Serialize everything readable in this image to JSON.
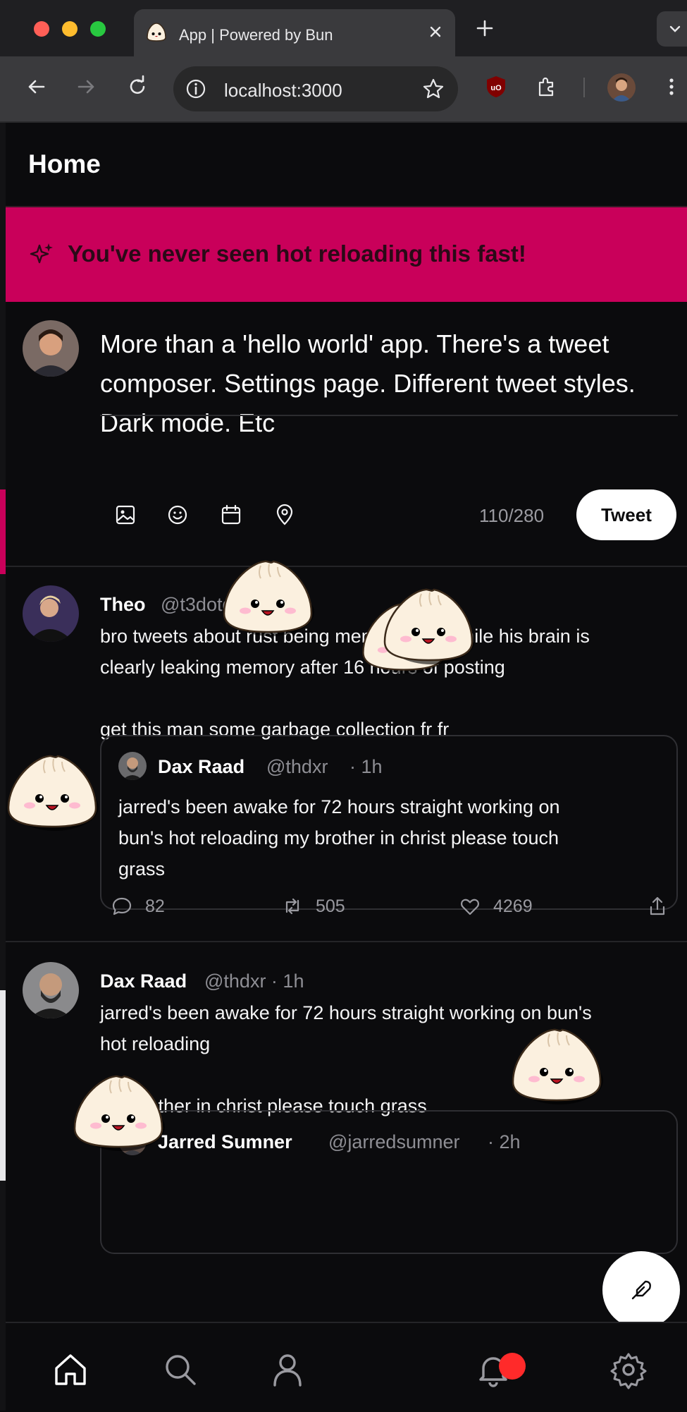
{
  "browser": {
    "tab_title": "App | Powered by Bun",
    "url": "localhost:3000"
  },
  "app": {
    "page_title": "Home",
    "banner_text": "You've never seen hot reloading this fast!",
    "composer": {
      "text": "More than a 'hello world' app. There's a tweet composer. Settings page. Different tweet styles. Dark mode. Etc",
      "char_count": "110/280",
      "submit_label": "Tweet",
      "tools": [
        "image-icon",
        "emoji-icon",
        "calendar-icon",
        "location-icon"
      ]
    },
    "tweets": [
      {
        "name": "Theo",
        "handle": "@t3dotgg · 45m",
        "body_lines": [
          "bro tweets about rust being memory safe while his brain is",
          "clearly leaking memory after 16 hours of posting",
          "",
          "get this man some garbage collection fr fr"
        ],
        "quote": {
          "name": "Dax Raad",
          "handle": "@thdxr",
          "time": "· 1h",
          "body_lines": [
            "jarred's been awake for 72 hours straight working on",
            "bun's hot reloading my brother in christ please touch",
            "grass"
          ]
        },
        "replies": "82",
        "retweets": "505",
        "likes": "4269"
      },
      {
        "name": "Dax Raad",
        "handle": "@thdxr · 1h",
        "body_lines": [
          "jarred's been awake for 72 hours straight working on bun's",
          "hot reloading",
          "",
          "my brother in christ please touch grass"
        ],
        "quote": {
          "name": "Jarred Sumner",
          "handle": "@jarredsumner",
          "time": "· 2h"
        }
      }
    ],
    "colors": {
      "banner": "#c9005a",
      "background": "#0b0b0d",
      "notification_dot": "#ff2a2a"
    }
  },
  "bottom_nav": [
    "home-icon",
    "search-icon",
    "profile-icon",
    "notifications-icon",
    "settings-icon"
  ]
}
